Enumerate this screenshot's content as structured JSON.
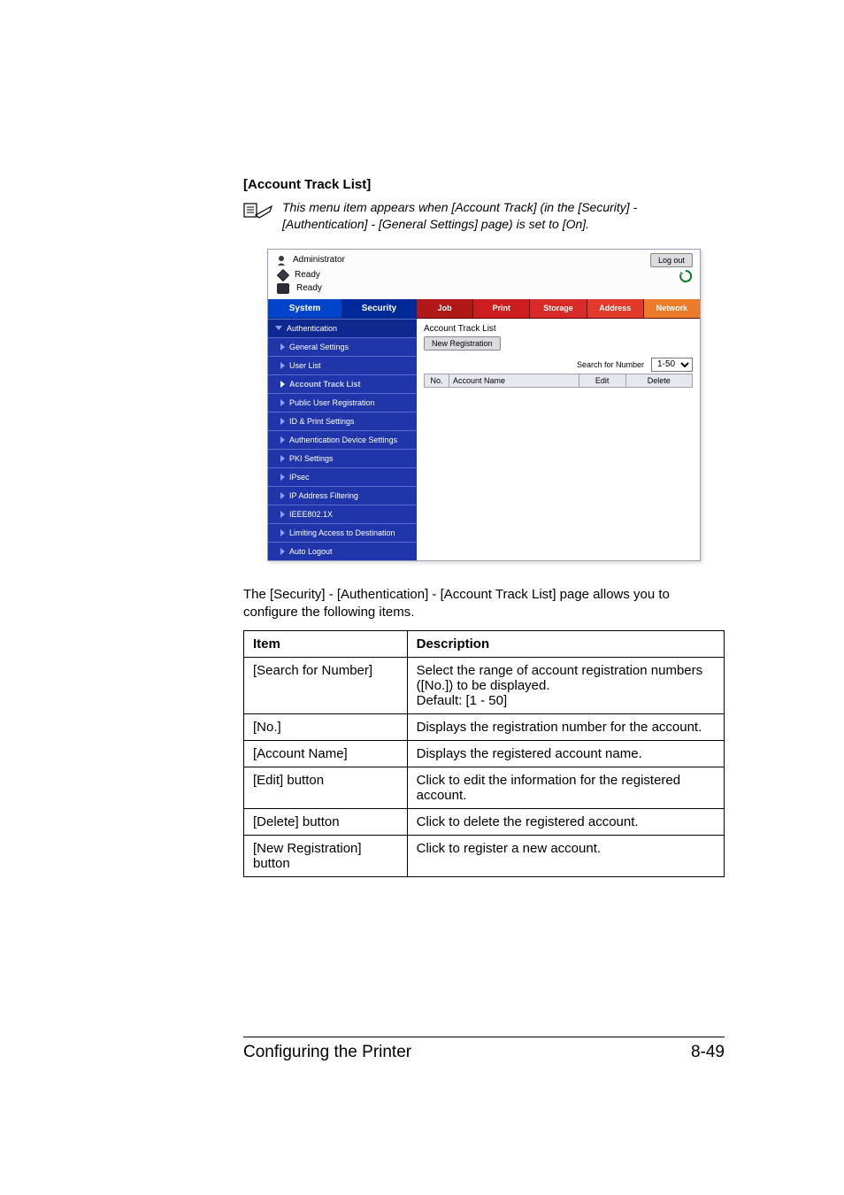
{
  "section_title": "[Account Track List]",
  "note_text": "This menu item appears when [Account Track] (in the [Security] - [Authentication] - [General Settings] page) is set to [On].",
  "screenshot": {
    "who_label": "Administrator",
    "logout_label": "Log out",
    "status1": "Ready",
    "status2": "Ready",
    "left_tabs": {
      "system": "System",
      "security": "Security"
    },
    "sidebar": {
      "heading": "Authentication",
      "items": [
        "General Settings",
        "User List",
        "Account Track List",
        "Public User Registration",
        "ID & Print Settings",
        "Authentication Device Settings",
        "PKI Settings",
        "IPsec",
        "IP Address Filtering",
        "IEEE802.1X",
        "Limiting Access to Destination",
        "Auto Logout"
      ],
      "active_index": 2
    },
    "ribbon": {
      "job": "Job",
      "print": "Print",
      "storage": "Storage",
      "address": "Address",
      "network": "Network"
    },
    "pane": {
      "title": "Account Track List",
      "new_registration": "New Registration",
      "search_label": "Search for Number",
      "search_value": "1-50",
      "table_headers": {
        "no": "No.",
        "name": "Account Name",
        "edit": "Edit",
        "delete": "Delete"
      }
    }
  },
  "intro_text": "The [Security] - [Authentication] - [Account Track List] page allows you to configure the following items.",
  "table": {
    "head_item": "Item",
    "head_desc": "Description",
    "rows": [
      {
        "item": "[Search for Number]",
        "desc": "Select the range of account registration numbers ([No.]) to be displayed.\nDefault: [1 - 50]"
      },
      {
        "item": "[No.]",
        "desc": "Displays the registration number for the account."
      },
      {
        "item": "[Account Name]",
        "desc": "Displays the registered account name."
      },
      {
        "item": "[Edit] button",
        "desc": "Click to edit the information for the registered account."
      },
      {
        "item": "[Delete] button",
        "desc": "Click to delete the registered account."
      },
      {
        "item": "[New Registration] button",
        "desc": "Click to register a new account."
      }
    ]
  },
  "footer_left": "Configuring the Printer",
  "footer_right": "8-49"
}
